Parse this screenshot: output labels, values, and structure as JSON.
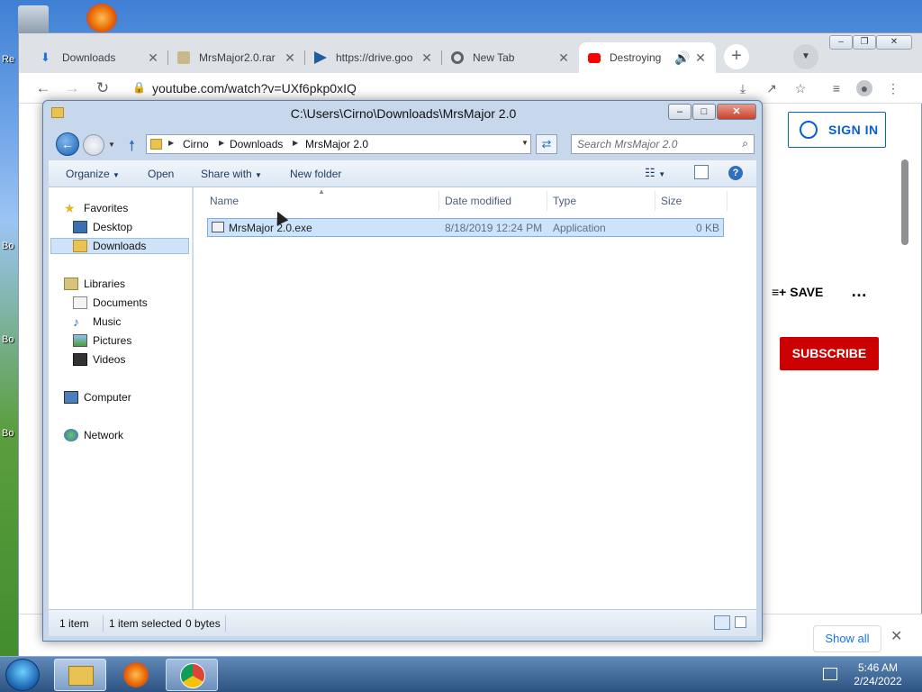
{
  "desktop": {
    "labels": [
      "Re",
      "Bo",
      "Bo",
      "Bo"
    ]
  },
  "chrome": {
    "tabs": [
      {
        "label": "Downloads",
        "icon": "download-icon"
      },
      {
        "label": "MrsMajor2.0.rar",
        "icon": "archive-icon"
      },
      {
        "label": "https://drive.goo",
        "icon": "drive-icon"
      },
      {
        "label": "New Tab",
        "icon": "chrome-icon"
      },
      {
        "label": "Destroying",
        "icon": "youtube-icon"
      }
    ],
    "new_tab_symbol": "+",
    "url": "youtube.com/watch?v=UXf6pkp0xIQ",
    "youtube": {
      "sign_in": "SIGN IN",
      "save": "SAVE",
      "subscribe": "SUBSCRIBE"
    },
    "download_bar": {
      "show_all": "Show all"
    }
  },
  "explorer": {
    "title": "C:\\Users\\Cirno\\Downloads\\MrsMajor 2.0",
    "breadcrumb": [
      "Cirno",
      "Downloads",
      "MrsMajor 2.0"
    ],
    "search_placeholder": "Search MrsMajor 2.0",
    "commands": {
      "organize": "Organize",
      "open": "Open",
      "share_with": "Share with",
      "new_folder": "New folder"
    },
    "nav": {
      "favorites": "Favorites",
      "desktop": "Desktop",
      "downloads": "Downloads",
      "libraries": "Libraries",
      "documents": "Documents",
      "music": "Music",
      "pictures": "Pictures",
      "videos": "Videos",
      "computer": "Computer",
      "network": "Network"
    },
    "columns": [
      "Name",
      "Date modified",
      "Type",
      "Size"
    ],
    "files": [
      {
        "name": "MrsMajor 2.0.exe",
        "date": "8/18/2019 12:24 PM",
        "type": "Application",
        "size": "0 KB"
      }
    ],
    "status": {
      "count": "1 item",
      "selected": "1 item selected",
      "bytes": "0 bytes"
    }
  },
  "taskbar": {
    "time": "5:46 AM",
    "date": "2/24/2022"
  },
  "colors": {
    "subscribe_red": "#cc0000",
    "youtube_blue": "#065fd4",
    "selection_blue": "#cce4fb"
  }
}
